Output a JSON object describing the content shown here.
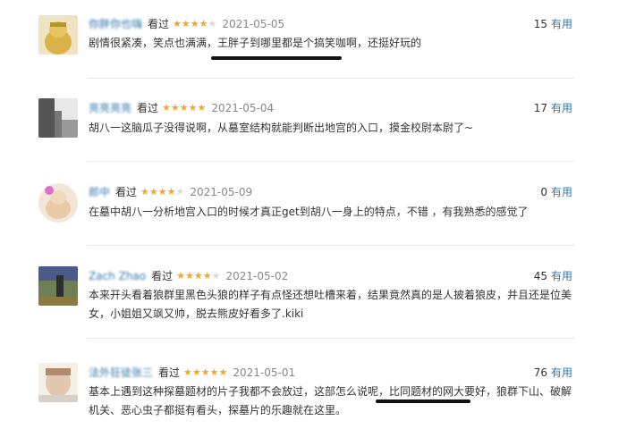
{
  "reviews": [
    {
      "username": "你胖你也嗨",
      "action": "看过",
      "stars": "★★★★",
      "stars_off": "★",
      "rating": 4,
      "date": "2021-05-05",
      "votes": "15",
      "useful": "有用",
      "text": "剧情很紧凑，笑点也满满，王胖子到哪里都是个搞笑咖啊，还挺好玩的"
    },
    {
      "username": "亮亮亮亮",
      "action": "看过",
      "stars": "★★★★★",
      "stars_off": "",
      "rating": 5,
      "date": "2021-05-04",
      "votes": "17",
      "useful": "有用",
      "text": "胡八一这脑瓜子没得说啊，从墓室结构就能判断出地宫的入口，摸金校尉本尉了~"
    },
    {
      "username": "郎中",
      "action": "看过",
      "stars": "★★★★",
      "stars_off": "★",
      "rating": 4,
      "date": "2021-05-09",
      "votes": "0",
      "useful": "有用",
      "text": "在墓中胡八一分析地宫入口的时候才真正get到胡八一身上的特点，不错 ，有我熟悉的感觉了"
    },
    {
      "username": "Zach Zhao",
      "action": "看过",
      "stars": "★★★★",
      "stars_off": "★",
      "rating": 4,
      "date": "2021-05-02",
      "votes": "45",
      "useful": "有用",
      "text": "本来开头看着狼群里黑色头狼的样子有点怪还想吐槽来着，结果竟然真的是人披着狼皮，并且还是位美女，小姐姐又飒又帅，脱去熊皮好看多了.kiki"
    },
    {
      "username": "法外狂徒张三",
      "action": "看过",
      "stars": "★★★★★",
      "stars_off": "",
      "rating": 5,
      "date": "2021-05-01",
      "votes": "76",
      "useful": "有用",
      "text": "基本上遇到这种探墓题材的片子我都不会放过，这部怎么说呢，比同题材的网大要好，狼群下山、破解机关、恶心虫子都挺有看头，探墓片的乐趣就在这里。"
    }
  ]
}
